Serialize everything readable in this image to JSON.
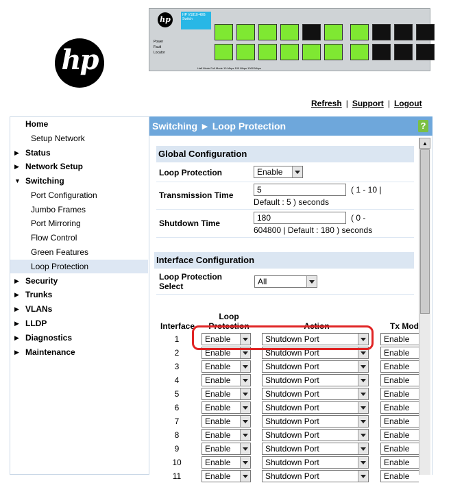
{
  "logo": {
    "text": "hp"
  },
  "switch_image": {
    "model_text": "HP V1810-48G Switch",
    "status_labels": [
      "Power",
      "Fault",
      "Locator"
    ],
    "footer": "Half Mode  Full Mode  10 Mbps  100 Mbps  1000 Mbps"
  },
  "top_links": {
    "refresh": "Refresh",
    "support": "Support",
    "logout": "Logout",
    "separator": "|"
  },
  "sidebar": {
    "items": [
      {
        "label": "Home",
        "level": 0,
        "arrow": ""
      },
      {
        "label": "Setup Network",
        "level": 1,
        "arrow": ""
      },
      {
        "label": "Status",
        "level": 0,
        "arrow": "▶"
      },
      {
        "label": "Network Setup",
        "level": 0,
        "arrow": "▶"
      },
      {
        "label": "Switching",
        "level": 0,
        "arrow": "▼"
      },
      {
        "label": "Port Configuration",
        "level": 1,
        "arrow": ""
      },
      {
        "label": "Jumbo Frames",
        "level": 1,
        "arrow": ""
      },
      {
        "label": "Port Mirroring",
        "level": 1,
        "arrow": ""
      },
      {
        "label": "Flow Control",
        "level": 1,
        "arrow": ""
      },
      {
        "label": "Green Features",
        "level": 1,
        "arrow": ""
      },
      {
        "label": "Loop Protection",
        "level": 1,
        "arrow": "",
        "active": true
      },
      {
        "label": "Security",
        "level": 0,
        "arrow": "▶"
      },
      {
        "label": "Trunks",
        "level": 0,
        "arrow": "▶"
      },
      {
        "label": "VLANs",
        "level": 0,
        "arrow": "▶"
      },
      {
        "label": "LLDP",
        "level": 0,
        "arrow": "▶"
      },
      {
        "label": "Diagnostics",
        "level": 0,
        "arrow": "▶"
      },
      {
        "label": "Maintenance",
        "level": 0,
        "arrow": "▶"
      }
    ]
  },
  "header": {
    "title": "Switching ► Loop Protection",
    "help_icon": "?"
  },
  "global_config": {
    "title": "Global Configuration",
    "loop_protection": {
      "label": "Loop Protection",
      "value": "Enable"
    },
    "transmission_time": {
      "label": "Transmission Time",
      "value": "5",
      "hint_line1": "( 1 - 10 |",
      "hint_line2": "Default : 5 ) seconds"
    },
    "shutdown_time": {
      "label": "Shutdown Time",
      "value": "180",
      "hint_line1": "( 0 -",
      "hint_line2": "604800 | Default : 180 ) seconds"
    }
  },
  "interface_config": {
    "title": "Interface Configuration",
    "select_label_line1": "Loop Protection",
    "select_label_line2": "Select",
    "select_value": "All"
  },
  "table": {
    "headers": {
      "interface": "Interface",
      "loop_line1": "Loop",
      "loop_line2": "Protection",
      "action": "Action",
      "tx_mode": "Tx Mod"
    },
    "rows": [
      {
        "interface": "1",
        "loop": "Enable",
        "action": "Shutdown Port",
        "tx": "Enable"
      },
      {
        "interface": "2",
        "loop": "Enable",
        "action": "Shutdown Port",
        "tx": "Enable"
      },
      {
        "interface": "3",
        "loop": "Enable",
        "action": "Shutdown Port",
        "tx": "Enable"
      },
      {
        "interface": "4",
        "loop": "Enable",
        "action": "Shutdown Port",
        "tx": "Enable"
      },
      {
        "interface": "5",
        "loop": "Enable",
        "action": "Shutdown Port",
        "tx": "Enable"
      },
      {
        "interface": "6",
        "loop": "Enable",
        "action": "Shutdown Port",
        "tx": "Enable"
      },
      {
        "interface": "7",
        "loop": "Enable",
        "action": "Shutdown Port",
        "tx": "Enable"
      },
      {
        "interface": "8",
        "loop": "Enable",
        "action": "Shutdown Port",
        "tx": "Enable"
      },
      {
        "interface": "9",
        "loop": "Enable",
        "action": "Shutdown Port",
        "tx": "Enable"
      },
      {
        "interface": "10",
        "loop": "Enable",
        "action": "Shutdown Port",
        "tx": "Enable"
      },
      {
        "interface": "11",
        "loop": "Enable",
        "action": "Shutdown Port",
        "tx": "Enable"
      }
    ]
  }
}
